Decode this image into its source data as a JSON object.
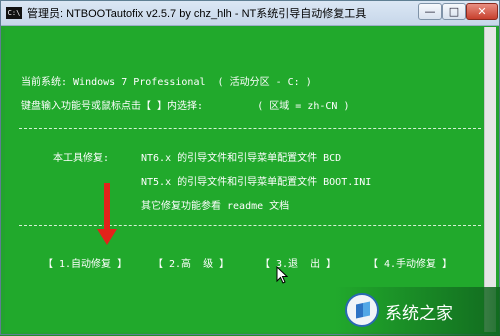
{
  "window": {
    "title": "管理员:  NTBOOTautofix v2.5.7 by chz_hlh - NT系统引导自动修复工具",
    "icon_label": "C:\\",
    "controls": {
      "minimize": "—",
      "maximize": "□",
      "close": "✕"
    }
  },
  "console": {
    "system_line": "当前系统: Windows 7 Professional  ( 活动分区 - C: )",
    "input_line": "键盘输入功能号或鼠标点击【 】内选择:         ( 区域 = zh-CN )",
    "tool_label": "本工具修复:",
    "fix_items": [
      "NT6.x 的引导文件和引导菜单配置文件 BCD",
      "NT5.x 的引导文件和引导菜单配置文件 BOOT.INI"
    ],
    "readme_line": "其它修复功能参看 readme 文档",
    "menu": [
      {
        "label": "【 1.自动修复 】"
      },
      {
        "label": "【 2.高  级 】"
      },
      {
        "label": "【 3.退  出 】"
      },
      {
        "label": "【 4.手动修复 】"
      }
    ]
  },
  "watermark": {
    "text": "系统之家",
    "logo_icon": "windows-logo-icon"
  },
  "colors": {
    "console_bg": "#21a92c",
    "text": "#ffffff",
    "arrow": "#e2231a"
  }
}
